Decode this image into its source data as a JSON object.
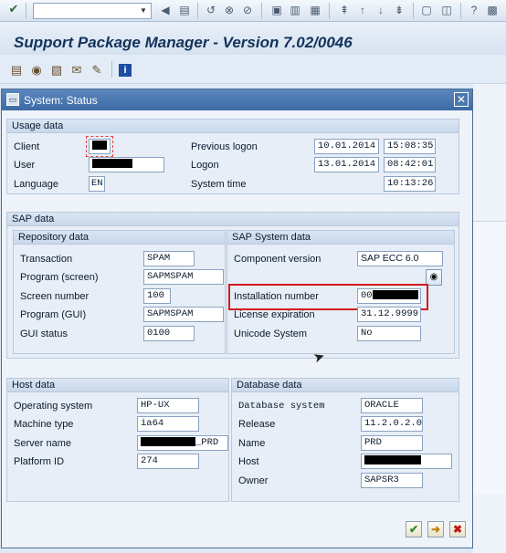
{
  "command_field": {
    "value": "",
    "placeholder": ""
  },
  "app_title": "Support Package Manager - Version 7.02/0046",
  "dialog": {
    "title": "System: Status",
    "usage": {
      "heading": "Usage data",
      "client_label": "Client",
      "user_label": "User",
      "language_label": "Language",
      "language_value": "EN",
      "previous_logon_label": "Previous logon",
      "previous_logon_date": "10.01.2014",
      "previous_logon_time": "15:08:35",
      "logon_label": "Logon",
      "logon_date": "13.01.2014",
      "logon_time": "08:42:01",
      "system_time_label": "System time",
      "system_time_value": "10:13:26"
    },
    "sap_data": {
      "heading": "SAP data",
      "repository": {
        "heading": "Repository data",
        "transaction_label": "Transaction",
        "transaction_value": "SPAM",
        "program_screen_label": "Program (screen)",
        "program_screen_value": "SAPMSPAM",
        "screen_number_label": "Screen number",
        "screen_number_value": "100",
        "program_gui_label": "Program (GUI)",
        "program_gui_value": "SAPMSPAM",
        "gui_status_label": "GUI status",
        "gui_status_value": "0100"
      },
      "system": {
        "heading": "SAP System data",
        "component_label": "Component version",
        "component_value": "SAP ECC 6.0",
        "installation_label": "Installation number",
        "installation_prefix": "00",
        "license_label": "License expiration",
        "license_value": "31.12.9999",
        "unicode_label": "Unicode System",
        "unicode_value": "No"
      }
    },
    "host": {
      "heading": "Host data",
      "os_label": "Operating system",
      "os_value": "HP-UX",
      "machine_label": "Machine type",
      "machine_value": "ia64",
      "server_label": "Server name",
      "server_suffix": "_PRD",
      "platform_label": "Platform ID",
      "platform_value": "274"
    },
    "database": {
      "heading": "Database data",
      "system_label": "Database system",
      "system_value": "ORACLE",
      "release_label": "Release",
      "release_value": "11.2.0.2.0",
      "name_label": "Name",
      "name_value": "PRD",
      "host_label": "Host",
      "owner_label": "Owner",
      "owner_value": "SAPSR3"
    }
  },
  "colors": {
    "highlight_box": "#d21c1c",
    "dialog_header": "#3d6aa3"
  }
}
